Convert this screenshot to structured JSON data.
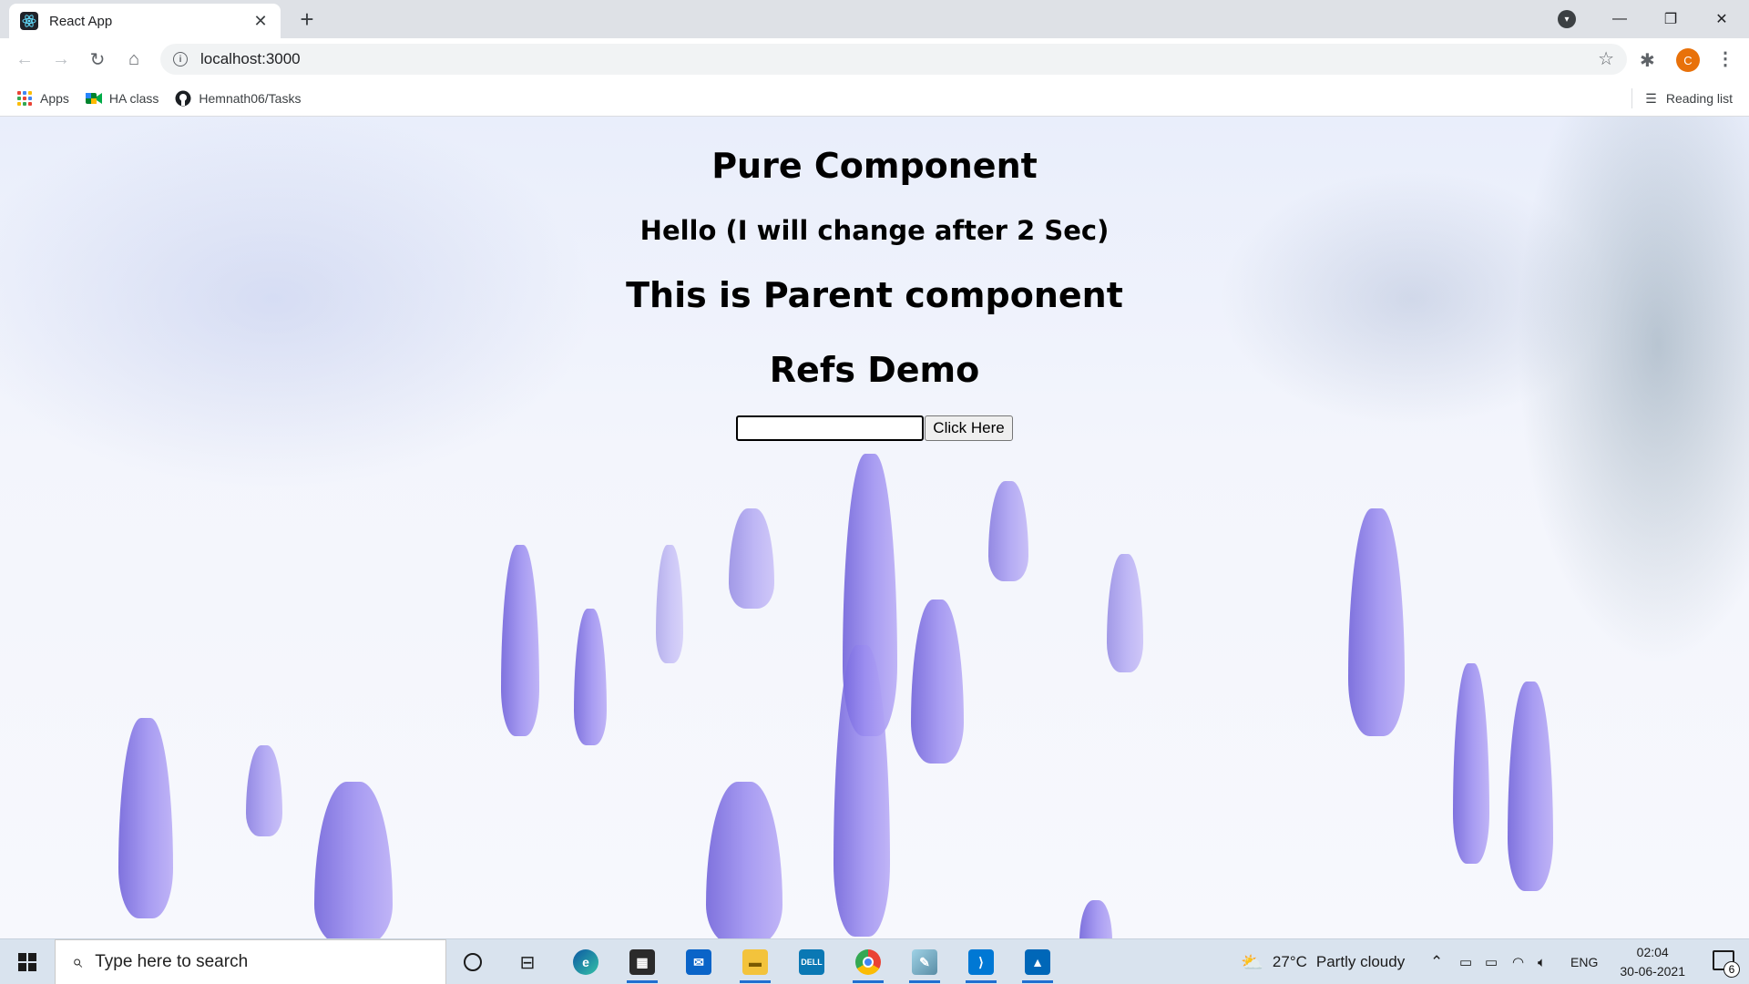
{
  "browser": {
    "tab_title": "React App",
    "url": "localhost:3000",
    "bookmarks": [
      {
        "label": "Apps"
      },
      {
        "label": "HA class"
      },
      {
        "label": "Hemnath06/Tasks"
      }
    ],
    "reading_list": "Reading list",
    "avatar_letter": "C"
  },
  "page": {
    "title": "Pure Component",
    "hello": "Hello (I will change after 2 Sec)",
    "parent": "This is Parent component",
    "refs_title": "Refs Demo",
    "input_value": "",
    "button_label": "Click Here"
  },
  "taskbar": {
    "search_placeholder": "Type here to search",
    "weather_temp": "27°C",
    "weather_text": "Partly cloudy",
    "language": "ENG",
    "time": "02:04",
    "date": "30-06-2021",
    "notification_count": "6"
  }
}
